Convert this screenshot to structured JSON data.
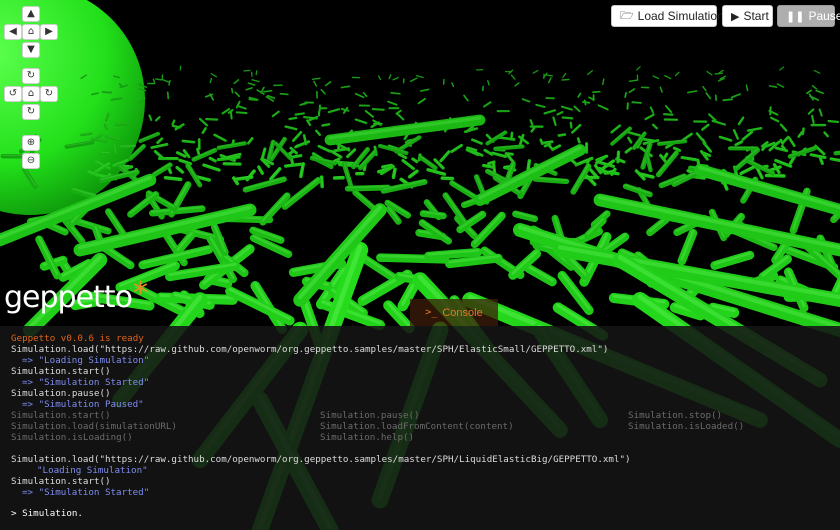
{
  "toolbar": {
    "load_label": "Load Simulation",
    "load_icon": "folder-open-icon",
    "start_label": "Start",
    "start_icon": "play-icon",
    "pause_label": "Pause",
    "pause_icon": "pause-icon"
  },
  "camera_controls": {
    "pan_up": "▲",
    "pan_left": "◀",
    "pan_home": "⌂",
    "pan_right": "▶",
    "pan_down": "▼",
    "rotate_up": "↻",
    "rotate_left": "↺",
    "rotate_home": "⌂",
    "rotate_right": "↻",
    "rotate_down": "↻",
    "zoom_in": "⊕",
    "zoom_out": "⊖"
  },
  "logo": {
    "text": "geppetto",
    "star": "*"
  },
  "console_tab": {
    "label": "Console",
    "icon": ">_"
  },
  "console": {
    "version_line": "Geppetto v0.0.6 is ready",
    "lines": [
      {
        "text": "Simulation.load(\"https://raw.github.com/openworm/org.geppetto.samples/master/SPH/ElasticSmall/GEPPETTO.xml\")",
        "kind": "cmd"
      },
      {
        "text": "=> \"Loading Simulation\"",
        "kind": "res"
      },
      {
        "text": "Simulation.start()",
        "kind": "cmd"
      },
      {
        "text": "=> \"Simulation Started\"",
        "kind": "res"
      },
      {
        "text": "Simulation.pause()",
        "kind": "cmd"
      },
      {
        "text": "=> \"Simulation Paused\"",
        "kind": "res"
      }
    ],
    "hints": [
      [
        "Simulation.start()",
        "Simulation.pause()",
        "Simulation.stop()"
      ],
      [
        "Simulation.load(simulationURL)",
        "Simulation.loadFromContent(content)",
        "Simulation.isLoaded()"
      ],
      [
        "Simulation.isLoading()",
        "Simulation.help()",
        ""
      ]
    ],
    "lines2": [
      {
        "text": "Simulation.load(\"https://raw.github.com/openworm/org.geppetto.samples/master/SPH/LiquidElasticBig/GEPPETTO.xml\")",
        "kind": "cmd"
      },
      {
        "text": "\"Loading Simulation\"",
        "kind": "res"
      },
      {
        "text": "Simulation.start()",
        "kind": "cmd"
      },
      {
        "text": "=> \"Simulation Started\"",
        "kind": "res"
      }
    ],
    "prompt_symbol": ">",
    "input_value": "Simulation."
  },
  "colors": {
    "accent": "#f08a24",
    "structure": "#1fd11f"
  }
}
